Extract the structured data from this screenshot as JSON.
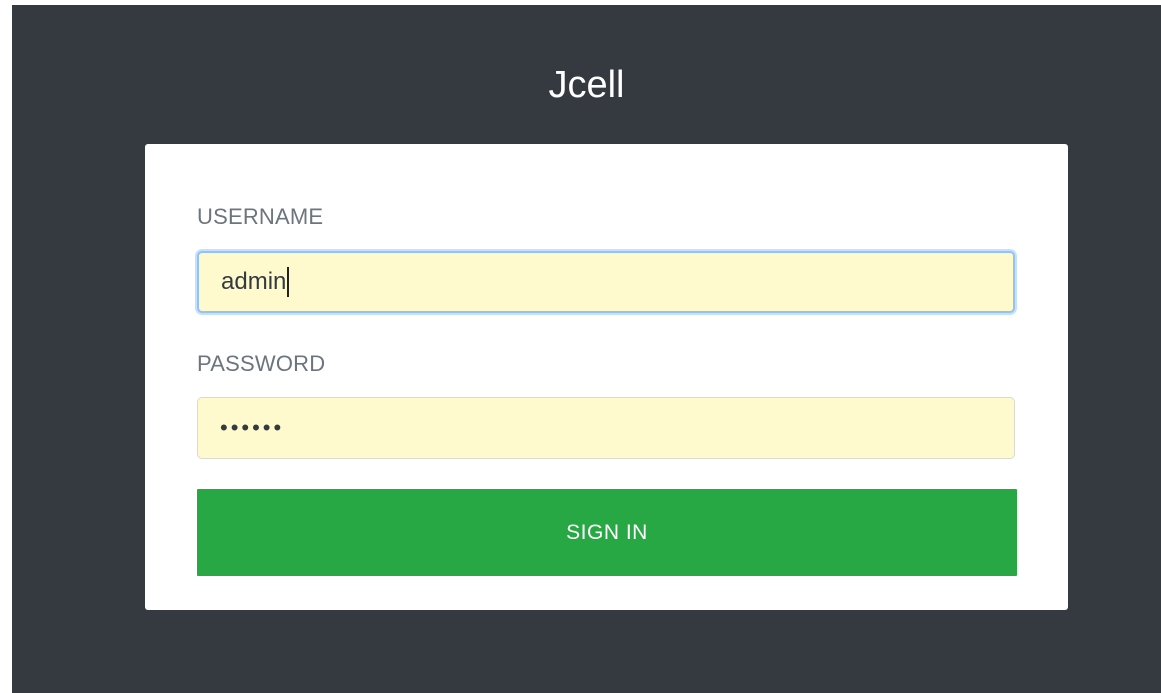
{
  "app": {
    "title": "Jcell"
  },
  "login_form": {
    "username_label": "USERNAME",
    "username_value": "admin",
    "password_label": "PASSWORD",
    "password_masked": "••••••",
    "sign_in_label": "SIGN IN"
  },
  "colors": {
    "background": "#343a40",
    "card": "#ffffff",
    "autofill": "#fffacd",
    "focus_ring": "#80bdff",
    "sign_in_button": "#28a745"
  }
}
